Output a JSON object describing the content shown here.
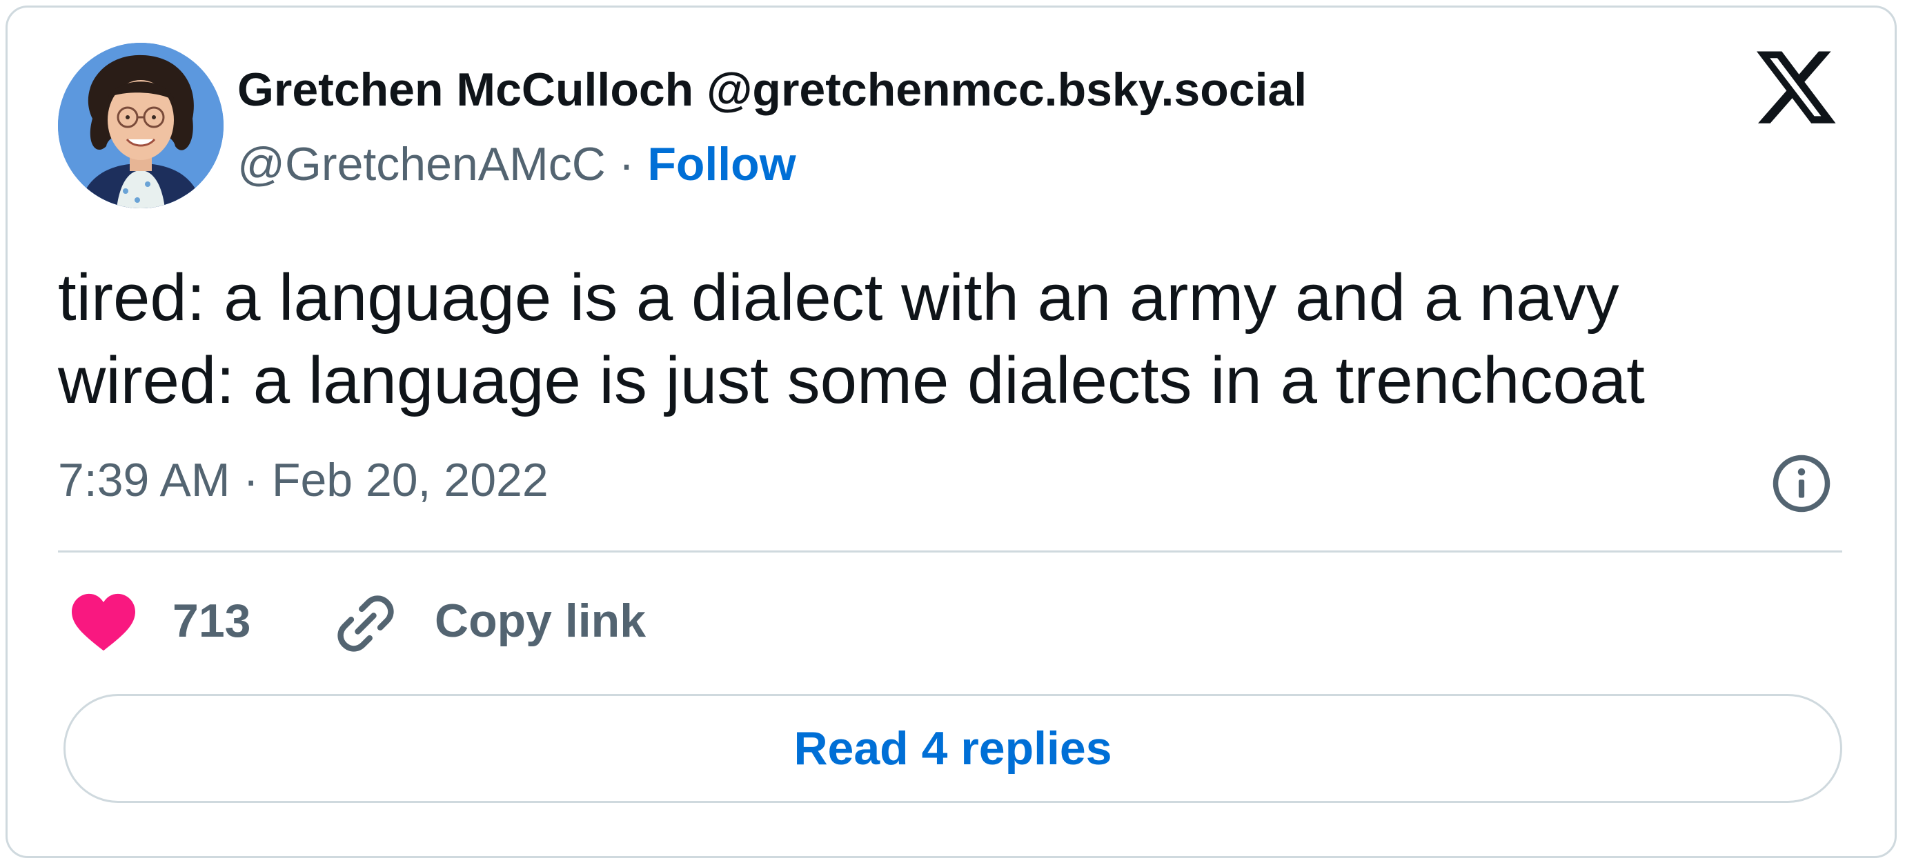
{
  "author": {
    "display_name": "Gretchen McCulloch @gretchenmcc.bsky.social",
    "handle": "@GretchenAMcC",
    "separator": "·",
    "follow_label": "Follow"
  },
  "tweet": {
    "line_1": "tired: a language is a dialect with an army and a navy",
    "line_2": "wired: a language is just some dialects in a trenchcoat",
    "timestamp": "7:39 AM · Feb 20, 2022"
  },
  "actions": {
    "like_count": "713",
    "copy_link_label": "Copy link",
    "read_replies_label": "Read 4 replies"
  },
  "icons": {
    "logo": "x-logo-icon",
    "info": "info-icon",
    "like": "heart-icon",
    "link": "link-icon"
  },
  "colors": {
    "text_primary": "#0f1419",
    "text_secondary": "#536471",
    "accent_blue": "#006fd6",
    "like_pink": "#f91880",
    "border": "#cfd9de"
  }
}
